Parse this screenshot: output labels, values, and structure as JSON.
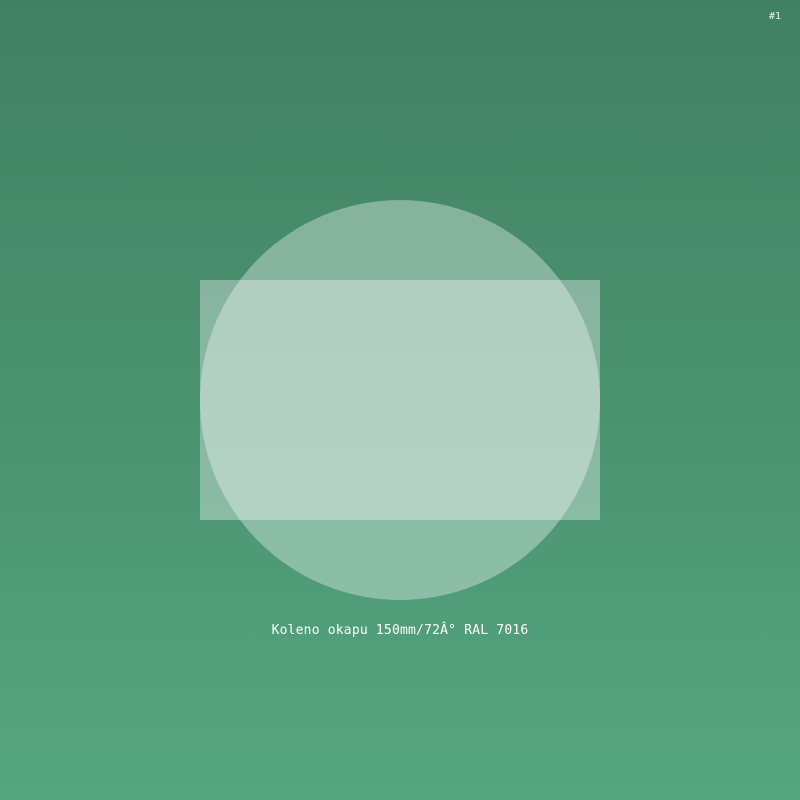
{
  "badge": "#1",
  "caption": "Koleno okapu 150mm/72Â° RAL 7016",
  "colors": {
    "background_top": "#418163",
    "background_bottom": "#55a680",
    "shape_fill": "rgba(255,255,255,0.35)",
    "text": "#ffffff"
  }
}
